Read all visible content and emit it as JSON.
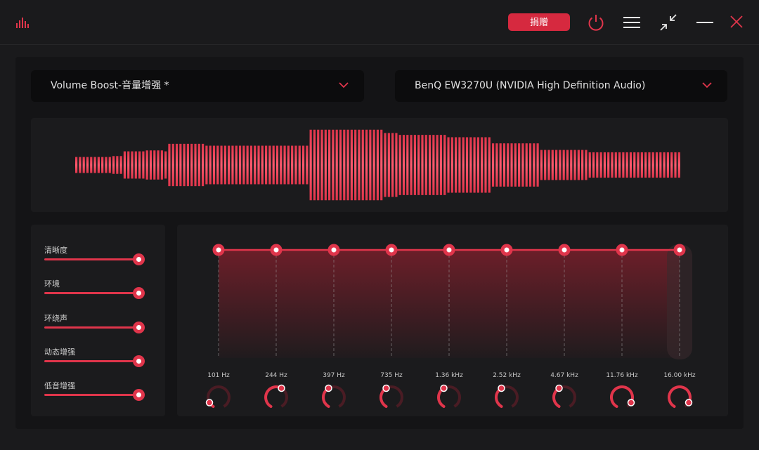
{
  "app": {
    "donate_label": "捐赠",
    "icons": [
      "logo-bars-icon",
      "power-icon",
      "menu-icon",
      "minimize-to-mini-icon",
      "minimize-icon",
      "close-icon"
    ],
    "colors": {
      "accent": "#e0354b",
      "background": "#1a1a1c",
      "panel": "#1b1b1d"
    }
  },
  "preset_select": {
    "value": "Volume Boost-音量增强 *"
  },
  "device_select": {
    "value": "BenQ EW3270U (NVIDIA High Definition Audio)"
  },
  "effects": [
    {
      "label": "清晰度",
      "level": 1.0
    },
    {
      "label": "环境",
      "level": 1.0
    },
    {
      "label": "环绕声",
      "level": 1.0
    },
    {
      "label": "动态增强",
      "level": 1.0
    },
    {
      "label": "低音增强",
      "level": 1.0
    }
  ],
  "equalizer": {
    "bands": [
      {
        "label": "101 Hz",
        "knob": 0.1
      },
      {
        "label": "244 Hz",
        "knob": 0.6
      },
      {
        "label": "397 Hz",
        "knob": 0.4
      },
      {
        "label": "735 Hz",
        "knob": 0.4
      },
      {
        "label": "1.36 kHz",
        "knob": 0.4
      },
      {
        "label": "2.52 kHz",
        "knob": 0.4
      },
      {
        "label": "4.67 kHz",
        "knob": 0.4
      },
      {
        "label": "11.76 kHz",
        "knob": 0.9
      },
      {
        "label": "16.00 kHz",
        "knob": 0.9
      }
    ],
    "gain_level": 1.0
  },
  "visualizer": {
    "bar_levels": [
      0.17,
      0.17,
      0.17,
      0.17,
      0.17,
      0.17,
      0.17,
      0.17,
      0.17,
      0.17,
      0.19,
      0.19,
      0.19,
      0.29,
      0.29,
      0.29,
      0.29,
      0.29,
      0.29,
      0.31,
      0.31,
      0.31,
      0.31,
      0.31,
      0.29,
      0.45,
      0.45,
      0.45,
      0.45,
      0.45,
      0.45,
      0.45,
      0.45,
      0.45,
      0.45,
      0.41,
      0.41,
      0.41,
      0.41,
      0.41,
      0.41,
      0.41,
      0.41,
      0.41,
      0.41,
      0.41,
      0.41,
      0.41,
      0.41,
      0.41,
      0.41,
      0.41,
      0.41,
      0.41,
      0.41,
      0.41,
      0.41,
      0.41,
      0.41,
      0.41,
      0.41,
      0.41,
      0.41,
      0.75,
      0.75,
      0.75,
      0.75,
      0.75,
      0.75,
      0.75,
      0.75,
      0.75,
      0.75,
      0.75,
      0.75,
      0.75,
      0.75,
      0.75,
      0.75,
      0.75,
      0.75,
      0.75,
      0.75,
      0.68,
      0.68,
      0.68,
      0.68,
      0.64,
      0.64,
      0.64,
      0.64,
      0.64,
      0.64,
      0.64,
      0.64,
      0.64,
      0.64,
      0.64,
      0.64,
      0.64,
      0.59,
      0.59,
      0.59,
      0.59,
      0.59,
      0.59,
      0.59,
      0.59,
      0.59,
      0.59,
      0.59,
      0.59,
      0.46,
      0.46,
      0.46,
      0.46,
      0.46,
      0.46,
      0.46,
      0.46,
      0.46,
      0.46,
      0.46,
      0.46,
      0.46,
      0.32,
      0.32,
      0.32,
      0.32,
      0.32,
      0.32,
      0.32,
      0.32,
      0.32,
      0.32,
      0.32,
      0.32,
      0.32,
      0.27,
      0.27,
      0.27,
      0.27,
      0.27,
      0.27,
      0.27,
      0.27,
      0.27,
      0.27,
      0.27,
      0.27,
      0.27,
      0.27,
      0.27,
      0.27,
      0.27,
      0.27,
      0.27,
      0.27,
      0.27,
      0.27,
      0.27,
      0.27,
      0.27
    ]
  }
}
